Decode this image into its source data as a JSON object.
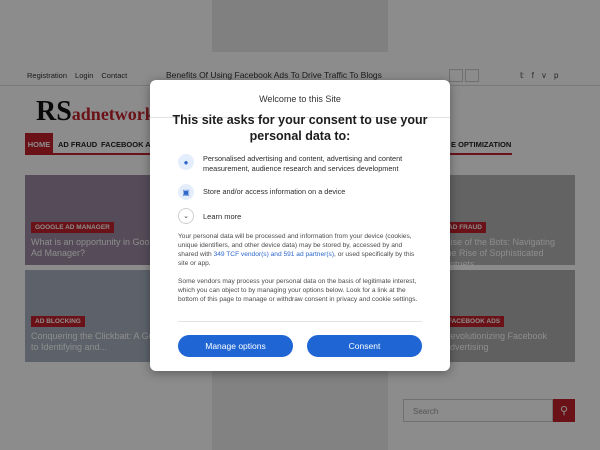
{
  "site": {
    "topbar_links": [
      "Registration",
      "Login",
      "Contact"
    ],
    "ticker": "Benefits Of Using Facebook Ads To Drive Traffic To Blogs",
    "social_icons": [
      "twitter-icon",
      "facebook-icon",
      "vimeo-icon",
      "pinterest-icon"
    ],
    "logo_big": "RS",
    "logo_small": "adnetwork",
    "nav": {
      "home": "HOME",
      "items": [
        "AD FRAUD",
        "FACEBOOK AD",
        "E OPTIMIZATION"
      ]
    },
    "cards": [
      {
        "tag": "GOOGLE AD MANAGER",
        "title": "What is an opportunity in Google Ad Manager?"
      },
      {
        "tag": "AD FRAUD",
        "title": "Rise of the Bots: Navigating the Rise of Sophisticated Botnets"
      },
      {
        "tag": "AD BLOCKING",
        "title": "Conquering the Clickbait: A Guide to Identifying and..."
      },
      {
        "tag": "FACEBOOK ADS",
        "title": "Revolutionizing Facebook Advertising"
      }
    ],
    "search_placeholder": "Search",
    "brand_color": "#c2222b"
  },
  "consent": {
    "window_title": "Welcome to this Site",
    "heading": "This site asks for your consent to use your personal data to:",
    "purposes": [
      {
        "icon": "person-icon",
        "text": "Personalised advertising and content, advertising and content measurement, audience research and services development"
      },
      {
        "icon": "device-icon",
        "text": "Store and/or access information on a device"
      }
    ],
    "learn_more": "Learn more",
    "paragraph1_a": "Your personal data will be processed and information from your device (cookies, unique identifiers, and other device data) may be stored by, accessed by and shared with ",
    "paragraph1_link": "349 TCF vendor(s) and 591 ad partner(s)",
    "paragraph1_b": ", or used specifically by this site or app.",
    "paragraph2": "Some vendors may process your personal data on the basis of legitimate interest, which you can object to by managing your options below. Look for a link at the bottom of this page to manage or withdraw consent in privacy and cookie settings.",
    "manage_button": "Manage options",
    "consent_button": "Consent",
    "button_color": "#1f66d4"
  }
}
